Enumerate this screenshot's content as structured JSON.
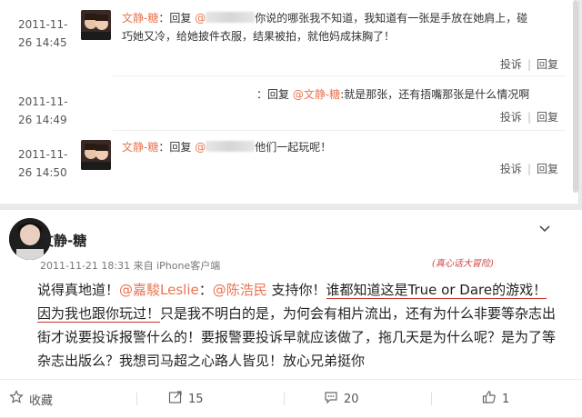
{
  "thread": {
    "report_label": "投诉",
    "reply_label": "回复",
    "replies": [
      {
        "date": "2011-11-",
        "time": "26 14:45",
        "has_avatar": true,
        "nick": "文静-糖",
        "reply_prefix": "：回复",
        "at": "@",
        "text_line1": "你说的哪张我不知道，我知道有一张是手放在她肩上，碰",
        "text_line2": "巧她又冷，给她披件衣服，结果被拍，就他妈成抹胸了！"
      },
      {
        "date": "2011-11-",
        "time": "26 14:49",
        "has_avatar": false,
        "prefix": "：回复",
        "at_nick": "@文静-糖",
        "text": ":就是那张，还有捂嘴那张是什么情况啊"
      },
      {
        "date": "2011-11-",
        "time": "26 14:50",
        "has_avatar": true,
        "nick": "文静-糖",
        "reply_prefix": "：回复",
        "at": "@",
        "text": "他们一起玩呢！"
      }
    ]
  },
  "post": {
    "author": "文静-糖",
    "meta": "2011-11-21 18:31 来自 iPhone客户端",
    "handwritten_note": "(真心话大冒险)",
    "body_part1": "说得真地道！",
    "mention1": "@嘉駿Leslie",
    "sep": "：",
    "mention2": "@陈浩民",
    "body_part2": " 支持你！",
    "underlined1": "谁都知道这是True or Dare的游",
    "underlined2": "戏！因为我也跟你玩过！",
    "body_part3": "只是我不明白的是，为何会有相片流出，还有为什么非要等杂志出街才说要投诉报警什么的！要报警要投诉早就应该做了，拖几天是为什么呢？是为了等杂志出版么？我想司马超之心路人皆见！放心兄弟挺你"
  },
  "actions": {
    "favorite_label": "收藏",
    "repost_count": "15",
    "comment_count": "20",
    "like_count": "1"
  }
}
